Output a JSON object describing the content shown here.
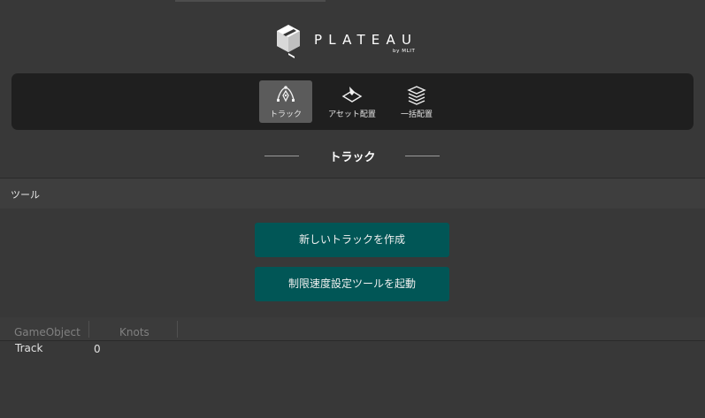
{
  "logo": {
    "text": "PLATEAU",
    "sub": "by MLIT"
  },
  "modes": [
    {
      "label": "トラック",
      "icon": "track-tool-icon",
      "active": true
    },
    {
      "label": "アセット配置",
      "icon": "asset-placement-icon",
      "active": false
    },
    {
      "label": "一括配置",
      "icon": "bulk-placement-icon",
      "active": false
    }
  ],
  "section": {
    "title": "トラック"
  },
  "tools": {
    "header": "ツール",
    "create_track_label": "新しいトラックを作成",
    "speed_limit_label": "制限速度設定ツールを起動"
  },
  "table": {
    "columns": [
      "GameObject",
      "Knots"
    ],
    "rows": [
      {
        "gameobject": "Track",
        "knots": "0"
      }
    ]
  },
  "colors": {
    "accent_button": "#015656",
    "mode_bar": "#1f1f1f",
    "background": "#383838"
  }
}
